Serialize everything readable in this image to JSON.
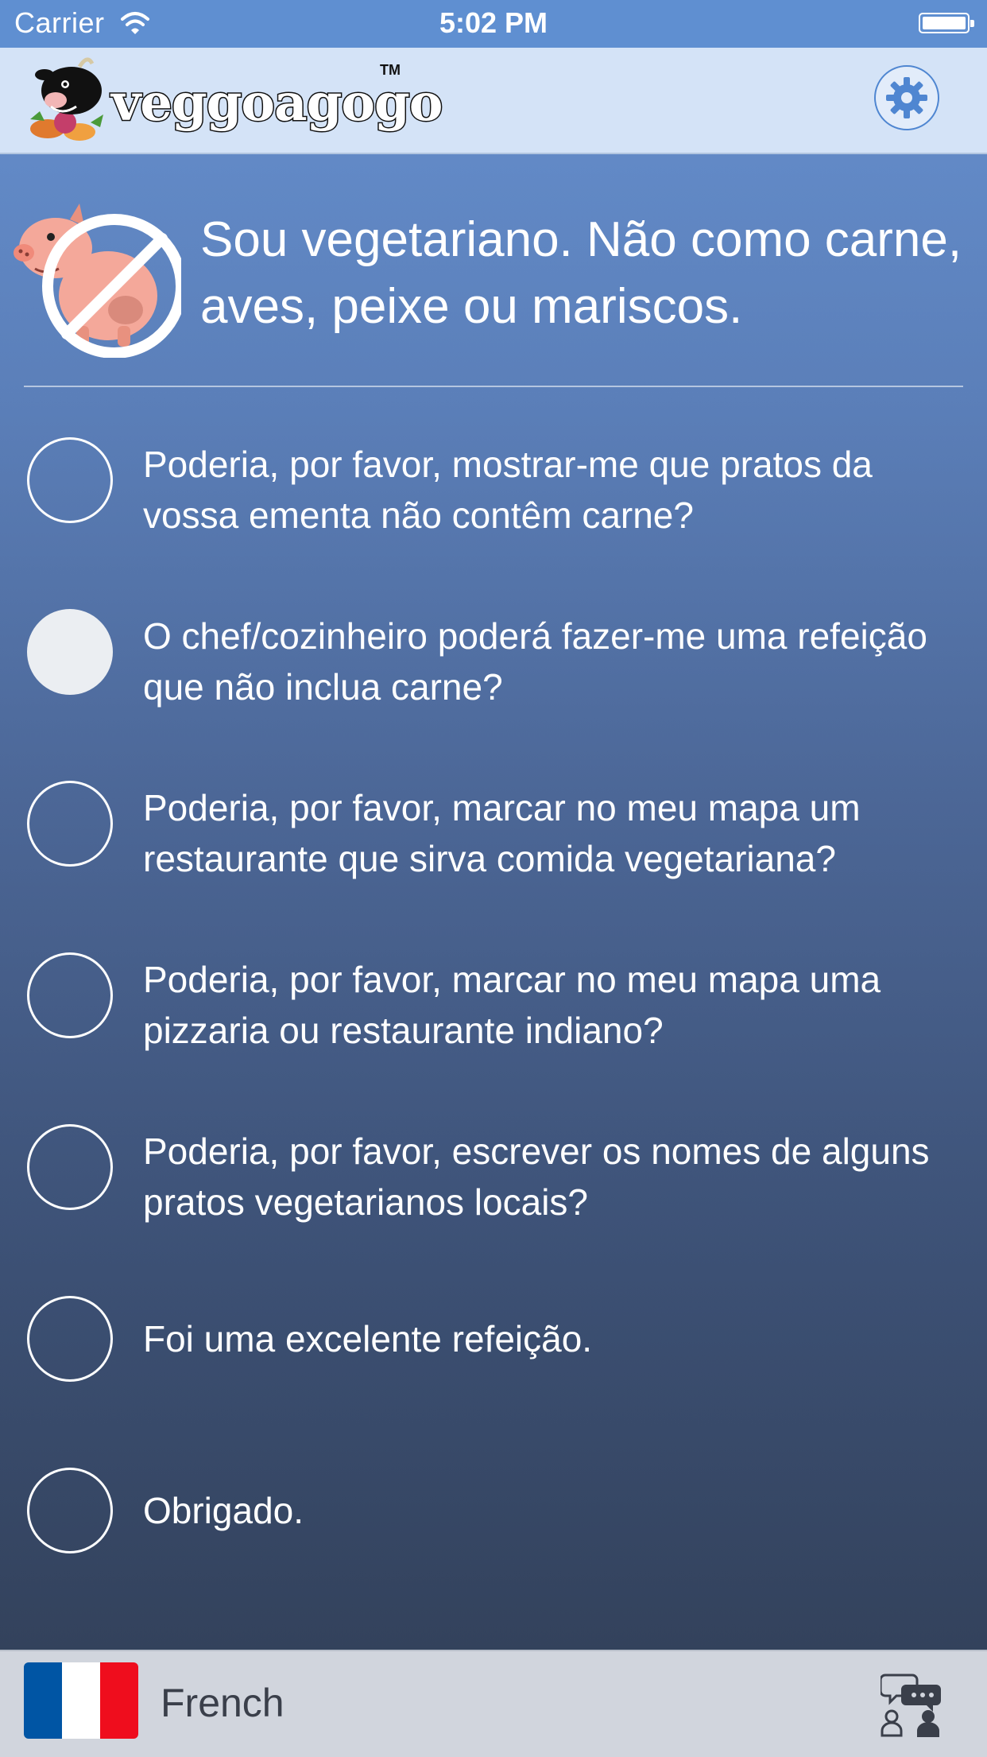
{
  "status_bar": {
    "carrier": "Carrier",
    "time": "5:02 PM"
  },
  "header": {
    "logo_text": "veggoagogo",
    "logo_tm": "TM"
  },
  "intro": {
    "text": "Sou vegetariano. Não como carne, aves, peixe ou mariscos."
  },
  "phrases": [
    {
      "text": "Poderia, por favor, mostrar-me que pratos da vossa ementa não contêm carne?",
      "selected": false
    },
    {
      "text": "O chef/cozinheiro poderá fazer-me uma refeição que não inclua carne?",
      "selected": true
    },
    {
      "text": "Poderia, por favor, marcar no meu mapa um restaurante que sirva comida vegetariana?",
      "selected": false
    },
    {
      "text": "Poderia, por favor, marcar no meu mapa uma pizzaria ou restaurante indiano?",
      "selected": false
    },
    {
      "text": "Poderia, por favor, escrever os nomes de alguns pratos vegetarianos locais?",
      "selected": false
    },
    {
      "text": "Foi uma excelente refeição.",
      "selected": false
    },
    {
      "text": "Obrigado.",
      "selected": false
    }
  ],
  "bottom_bar": {
    "language": "French",
    "flag_colors": [
      "#0055a4",
      "#ffffff",
      "#ef0d1d"
    ]
  },
  "colors": {
    "status_bar": "#5f8fd1",
    "header_bg": "#d4e3f7",
    "accent_gear": "#4f86d1",
    "selected_radio": "#ebeef2",
    "bottom_bar_bg": "#d1d5dd"
  }
}
